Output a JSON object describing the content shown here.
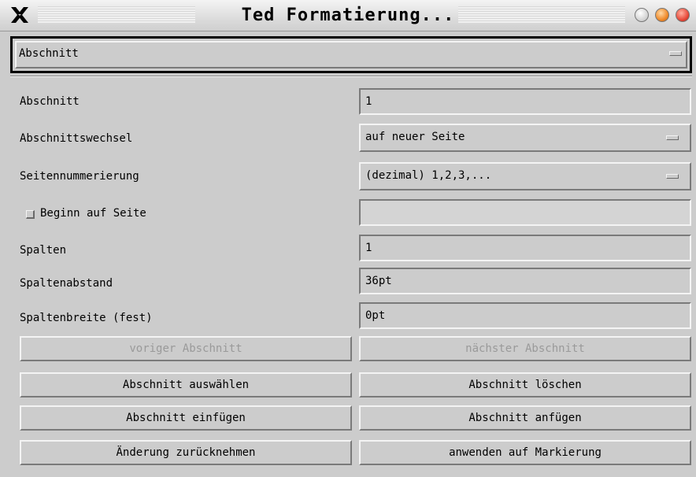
{
  "window": {
    "title": "Ted Formatierung...",
    "close_icon": "x-logo-icon",
    "buttons": [
      "minimize-icon",
      "maximize-icon",
      "close-icon"
    ]
  },
  "page_selector": {
    "value": "Abschnitt"
  },
  "rows": {
    "section_label": "Abschnitt",
    "section_value": "1",
    "break_label": "Abschnittswechsel",
    "break_value": "auf neuer Seite",
    "numbering_label": "Seitennummerierung",
    "numbering_value": "(dezimal) 1,2,3,...",
    "start_page_label": "Beginn auf Seite",
    "start_page_checked": false,
    "start_page_value": "",
    "columns_label": "Spalten",
    "columns_value": "1",
    "column_gap_label": "Spaltenabstand",
    "column_gap_value": "36pt",
    "column_width_label": "Spaltenbreite (fest)",
    "column_width_value": "0pt"
  },
  "buttons": {
    "prev_section": "voriger Abschnitt",
    "next_section": "nächster Abschnitt",
    "select_section": "Abschnitt auswählen",
    "delete_section": "Abschnitt löschen",
    "insert_section": "Abschnitt einfügen",
    "append_section": "Abschnitt anfügen",
    "revert": "Änderung zurücknehmen",
    "apply": "anwenden auf Markierung"
  },
  "colors": {
    "background": "#cccccc",
    "orange_button": "#f08a2a",
    "red_button": "#e84a3a"
  }
}
